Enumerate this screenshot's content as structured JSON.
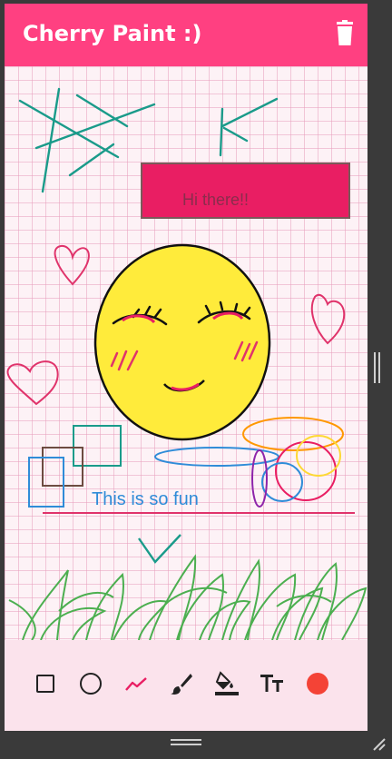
{
  "app": {
    "title": "Cherry Paint :)",
    "accent_color": "#ff4081",
    "canvas_bg": "#fdf2f6",
    "toolbar_bg": "#fbe3ec"
  },
  "header": {
    "delete_icon": "trash-icon"
  },
  "canvas": {
    "texts": {
      "greeting": "Hi there!!",
      "caption": "This is so fun"
    }
  },
  "toolbar": {
    "tools": [
      {
        "name": "rectangle-tool",
        "icon": "square-outline-icon"
      },
      {
        "name": "ellipse-tool",
        "icon": "circle-outline-icon"
      },
      {
        "name": "line-tool",
        "icon": "trend-line-icon",
        "selected": true
      },
      {
        "name": "brush-tool",
        "icon": "brush-icon"
      },
      {
        "name": "fill-tool",
        "icon": "fill-bucket-icon"
      },
      {
        "name": "text-tool",
        "icon": "text-size-icon"
      },
      {
        "name": "color-picker",
        "icon": "color-dot-icon",
        "color": "#f44336"
      }
    ]
  }
}
